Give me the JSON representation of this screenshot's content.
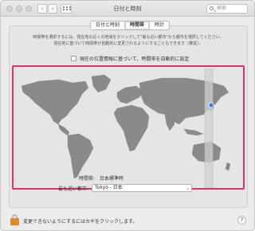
{
  "window": {
    "title": "日付と時刻",
    "search_placeholder": "検索"
  },
  "tabs": [
    {
      "label": "日付と時刻",
      "active": false
    },
    {
      "label": "時間帯",
      "active": true
    },
    {
      "label": "時計",
      "active": false
    }
  ],
  "description": {
    "line1": "時間帯を選択するには、現在地の近くの地域をクリックして\"最も近い都市\"から都市を選択してください。",
    "line2": "現在地に基づいて時間帯が自動的に変更されるようにすることもできます（推奨）。"
  },
  "auto_timezone": {
    "label": "現在の位置情報に基づいて、時間帯を自動的に設定",
    "checked": false
  },
  "timezone": {
    "label": "時間帯:",
    "value": "日本標準時"
  },
  "closest_city": {
    "label": "最も近い都市:",
    "value": "Tokyo - 日本"
  },
  "footer": {
    "lock_text": "変更できないようにするにはカギをクリックします。",
    "help_label": "?"
  },
  "colors": {
    "highlight_border": "#e0306a",
    "selected_pin": "#2f7cf6",
    "lock_body": "#e08a2a",
    "land": "#8a8a8a",
    "selected_zone": "#cfcfcf"
  },
  "icons": {
    "back": "chevron-left-icon",
    "forward": "chevron-right-icon",
    "show_all": "grid-icon",
    "search": "search-icon",
    "lock": "lock-icon",
    "help": "help-icon",
    "map_pin": "location-pin-icon"
  }
}
